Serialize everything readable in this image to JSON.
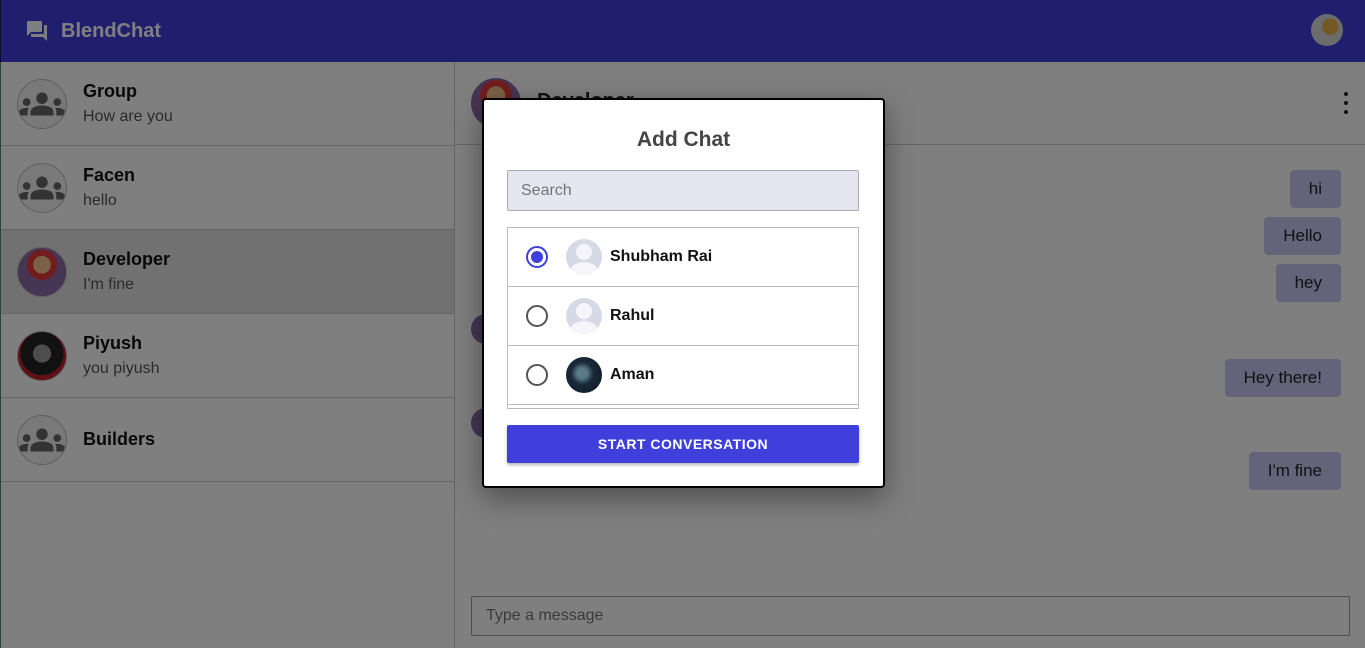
{
  "header": {
    "app_title": "BlendChat"
  },
  "sidebar": {
    "items": [
      {
        "name": "Group",
        "last_message": "How are you"
      },
      {
        "name": "Facen",
        "last_message": "hello"
      },
      {
        "name": "Developer",
        "last_message": "I'm fine"
      },
      {
        "name": "Piyush",
        "last_message": "you piyush"
      },
      {
        "name": "Builders",
        "last_message": ""
      }
    ]
  },
  "chat": {
    "title": "Developer",
    "messages": [
      "hi",
      "Hello",
      "hey",
      "Hey there!",
      "I'm fine"
    ],
    "composer_placeholder": "Type a message"
  },
  "modal": {
    "title": "Add Chat",
    "search_placeholder": "Search",
    "users": [
      {
        "name": "Shubham Rai",
        "selected": true
      },
      {
        "name": "Rahul",
        "selected": false
      },
      {
        "name": "Aman",
        "selected": false
      }
    ],
    "start_button": "START CONVERSATION"
  },
  "colors": {
    "primary": "#3f3fdc",
    "bubble": "#c6c6f4"
  }
}
